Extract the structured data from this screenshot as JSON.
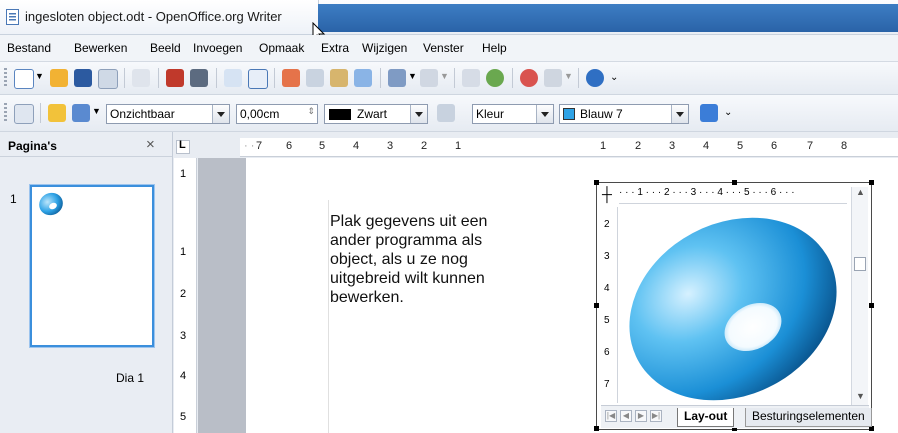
{
  "window": {
    "title": "ingesloten object.odt - OpenOffice.org Writer"
  },
  "menu": {
    "items": [
      "Bestand",
      "Bewerken",
      "Beeld",
      "Invoegen",
      "Opmaak",
      "Extra",
      "Wijzigen",
      "Venster",
      "Help"
    ]
  },
  "toolbar2": {
    "area_style": "Onzichtbaar",
    "line_width": "0,00cm",
    "line_color": "Zwart",
    "line_color_swatch": "#000000",
    "fill_type": "Kleur",
    "fill_color": "Blauw 7",
    "fill_color_swatch": "#2fa3e6"
  },
  "pages_panel": {
    "title": "Pagina's",
    "close": "×",
    "slide_number": "1",
    "slide_label": "Dia 1"
  },
  "ruler": {
    "horizontal": [
      "7",
      "6",
      "5",
      "4",
      "3",
      "2",
      "1",
      "1",
      "2",
      "3",
      "4",
      "5",
      "6",
      "7",
      "8"
    ],
    "vertical": [
      "1",
      "1",
      "2",
      "3",
      "4",
      "5"
    ]
  },
  "document": {
    "text_lines": [
      "Plak gegevens uit een",
      "ander programma als",
      "object, als u ze nog",
      "uitgebreid wilt kunnen",
      "bewerken."
    ]
  },
  "embedded_object": {
    "ruler_h": "· · · 1 · · · 2 · · · 3 · · · 4 · · · 5 · · · 6 · · ·",
    "ruler_v": [
      "2",
      "3",
      "4",
      "5",
      "6",
      "7"
    ],
    "tabs": [
      "Lay-out",
      "Besturingselementen"
    ]
  },
  "colors": {
    "title_blue": "#2a63a8",
    "torus": "#2fa3e6"
  }
}
